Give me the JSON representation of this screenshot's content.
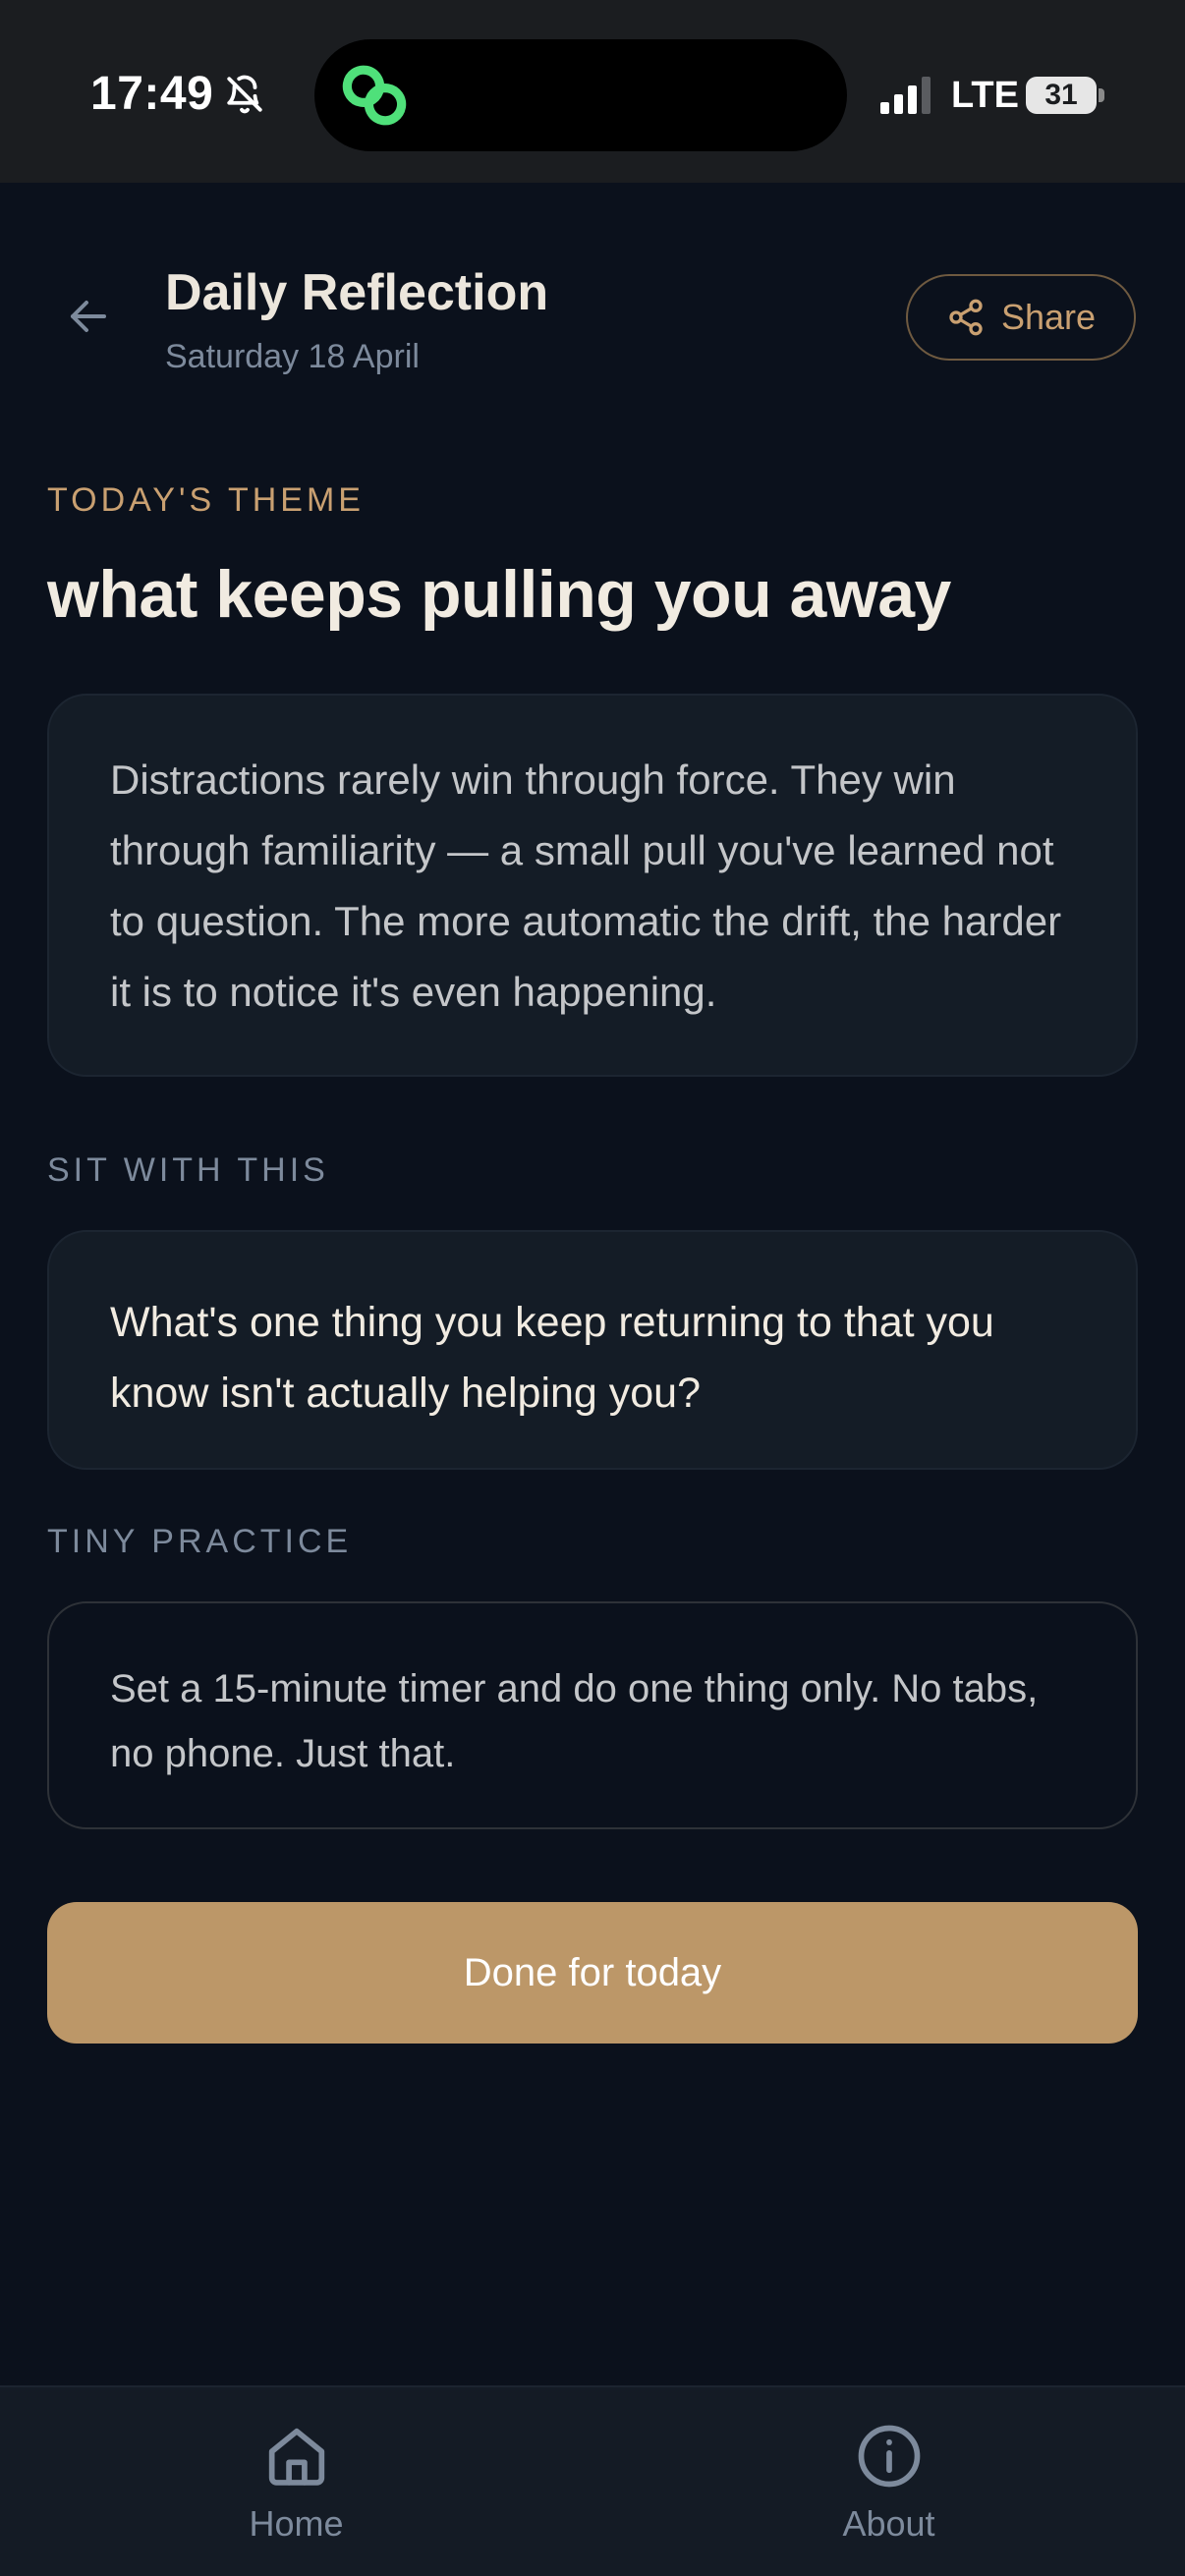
{
  "status_bar": {
    "time": "17:49",
    "network": "LTE",
    "battery": "31"
  },
  "header": {
    "title": "Daily Reflection",
    "date": "Saturday 18 April",
    "share_label": "Share"
  },
  "theme": {
    "label": "TODAY'S THEME",
    "title": "what keeps pulling you away",
    "body": "Distractions rarely win through force. They win through familiarity — a small pull you've learned not to question. The more automatic the drift, the harder it is to notice it's even happening."
  },
  "reflection": {
    "label": "SIT WITH THIS",
    "question": "What's one thing you keep returning to that you know isn't actually helping you?"
  },
  "practice": {
    "label": "TINY PRACTICE",
    "text": "Set a 15-minute timer and do one thing only. No tabs, no phone. Just that."
  },
  "done_label": "Done for today",
  "nav": {
    "home_label": "Home",
    "about_label": "About"
  },
  "colors": {
    "background": "#0b111c",
    "card": "#141c26",
    "accent": "#c9a071",
    "button": "#bc9768",
    "muted": "#7d8a9c",
    "app_icon_green": "#4fe07a"
  },
  "icons": [
    "bell-slash-icon",
    "link-icon",
    "signal-icon",
    "arrow-left-icon",
    "share-icon",
    "home-icon",
    "info-icon"
  ]
}
